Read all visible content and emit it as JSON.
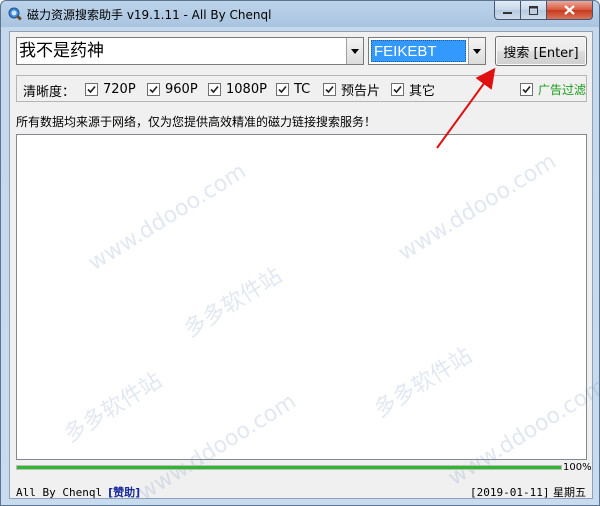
{
  "window": {
    "title": "磁力资源搜索助手 v19.1.11 - All By Chenql"
  },
  "search": {
    "query": "我不是药神",
    "source": "FEIKEBT",
    "button_label": "搜索 [Enter]"
  },
  "filters": {
    "label": "清晰度：",
    "options": [
      {
        "label": "720P",
        "checked": true
      },
      {
        "label": "960P",
        "checked": true
      },
      {
        "label": "1080P",
        "checked": true
      },
      {
        "label": "TC",
        "checked": true
      },
      {
        "label": "预告片",
        "checked": true
      },
      {
        "label": "其它",
        "checked": true
      }
    ],
    "ad_filter": {
      "label": "广告过滤",
      "checked": true
    }
  },
  "notice": "所有数据均来源于网络，仅为您提供高效精准的磁力链接搜索服务！",
  "progress": {
    "value": 1.0,
    "label": "100%"
  },
  "status": {
    "author": "All By Chenql",
    "sponsor": "[赞助]",
    "date": "[2019-01-11]",
    "weekday": "星期五"
  },
  "watermark": {
    "text_site": "www.ddooo.com",
    "text_name": "多多软件站"
  },
  "colors": {
    "progress": "#2eb82e",
    "selection": "#3399ff",
    "ad_filter_text": "#1a9c1a",
    "sponsor_link": "#1a2a9c",
    "annotation_arrow": "#e01010"
  }
}
